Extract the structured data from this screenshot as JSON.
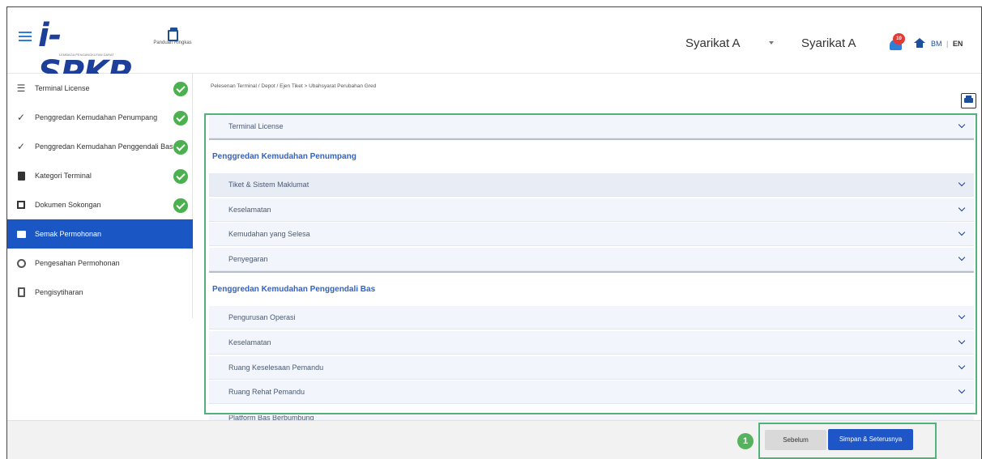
{
  "header": {
    "logo_text": "i-SPKP",
    "logo_sub": "LEMBAGA PENGANGKUTAN DARAT",
    "guide_label": "Panduan Ringkas",
    "company_select_value": "Syarikat A",
    "company_name": "Syarikat A",
    "notification_count": "10",
    "lang_bm": "BM",
    "lang_sep": "|",
    "lang_en": "EN"
  },
  "sidebar": {
    "items": [
      {
        "label": "Terminal License",
        "icon": "filter-lines-icon",
        "done": true
      },
      {
        "label": "Penggredan Kemudahan Penumpang",
        "icon": "grade-icon",
        "done": true
      },
      {
        "label": "Penggredan Kemudahan Penggendali Bas",
        "icon": "grade-icon",
        "done": true
      },
      {
        "label": "Kategori Terminal",
        "icon": "document-icon",
        "done": true
      },
      {
        "label": "Dokumen Sokongan",
        "icon": "library-icon",
        "done": true
      },
      {
        "label": "Semak Permohonan",
        "icon": "review-icon",
        "done": false,
        "active": true
      },
      {
        "label": "Pengesahan Permohonan",
        "icon": "verify-icon",
        "done": false
      },
      {
        "label": "Pengisytiharan",
        "icon": "clipboard-icon",
        "done": false
      }
    ]
  },
  "breadcrumb": "Pelesenan Terminal / Depot / Ejen Tiket > Ubahsyarat Perubahan Gred",
  "main": {
    "terminal_license": "Terminal License",
    "section1_title": "Penggredan Kemudahan Penumpang",
    "section1_items": [
      "Tiket & Sistem Maklumat",
      "Keselamatan",
      "Kemudahan yang Selesa",
      "Penyegaran"
    ],
    "section2_title": "Penggredan Kemudahan Penggendali Bas",
    "section2_items": [
      "Pengurusan Operasi",
      "Keselamatan",
      "Ruang Keselesaan Pemandu",
      "Ruang Rehat Pemandu",
      "Platform Bas Berbumbung"
    ]
  },
  "footer": {
    "step_number": "1",
    "prev_label": "Sebelum",
    "next_label": "Simpan & Seterusnya"
  },
  "colors": {
    "primary": "#1f56c7",
    "success": "#4caf50",
    "highlight_border": "#52b27b",
    "section_title": "#2f63c9"
  }
}
